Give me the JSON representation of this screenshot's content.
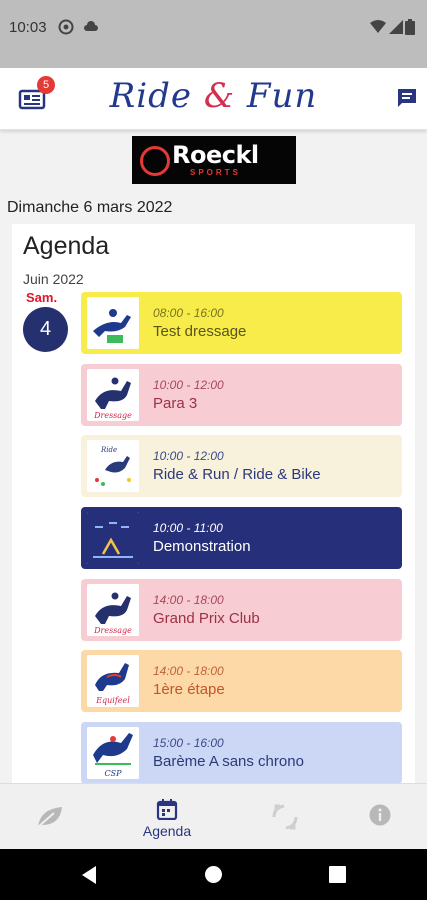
{
  "status_bar": {
    "time": "10:03"
  },
  "app_bar": {
    "title_part1": "Ride",
    "title_amp": "&",
    "title_part2": "Fun",
    "news_badge": "5"
  },
  "sponsor": {
    "name": "Roeckl",
    "tagline": "SPORTS"
  },
  "date_header": "Dimanche 6 mars 2022",
  "agenda": {
    "title": "Agenda",
    "month": "Juin 2022",
    "day_name": "Sam.",
    "day_number": "4",
    "events": [
      {
        "time": "08:00 - 16:00",
        "title": "Test dressage",
        "icon": "cce-horse-icon",
        "bg": "#f7ec4a",
        "time_color": "#7a7420",
        "title_color": "#5a5518"
      },
      {
        "time": "10:00 - 12:00",
        "title": "Para 3",
        "icon": "dressage-horse-icon",
        "bg": "#f7ccd3",
        "time_color": "#a8485a",
        "title_color": "#9c3146"
      },
      {
        "time": "10:00 - 12:00",
        "title": "Ride & Run / Ride & Bike",
        "icon": "ride-run-icon",
        "bg": "#f8f1dc",
        "time_color": "#3a4a8a",
        "title_color": "#2b3a7a"
      },
      {
        "time": "10:00 - 11:00",
        "title": "Demonstration",
        "icon": "demonstration-icon",
        "bg": "#26307a",
        "time_color": "#ffffff",
        "title_color": "#ffffff"
      },
      {
        "time": "14:00 - 18:00",
        "title": "Grand Prix Club",
        "icon": "dressage-horse-icon",
        "bg": "#f7ccd3",
        "time_color": "#a8485a",
        "title_color": "#9c3146"
      },
      {
        "time": "14:00 - 18:00",
        "title": "1ère étape",
        "icon": "equifeel-horse-icon",
        "bg": "#fcd9a6",
        "time_color": "#c2603a",
        "title_color": "#c2562f"
      },
      {
        "time": "15:00 - 16:00",
        "title": "Barème A sans chrono",
        "icon": "csp-jumping-icon",
        "bg": "#ccd7f6",
        "time_color": "#3a4a8a",
        "title_color": "#2b3a7a"
      }
    ]
  },
  "bottom_nav": {
    "items": [
      {
        "label": "",
        "icon": "leaf-icon"
      },
      {
        "label": "Agenda",
        "icon": "calendar-icon"
      },
      {
        "label": "",
        "icon": "rotate-icon"
      },
      {
        "label": "",
        "icon": "info-icon"
      }
    ]
  },
  "colors": {
    "brand_blue": "#233a8c",
    "brand_red": "#d32f4f",
    "day_red": "#e0162b"
  }
}
